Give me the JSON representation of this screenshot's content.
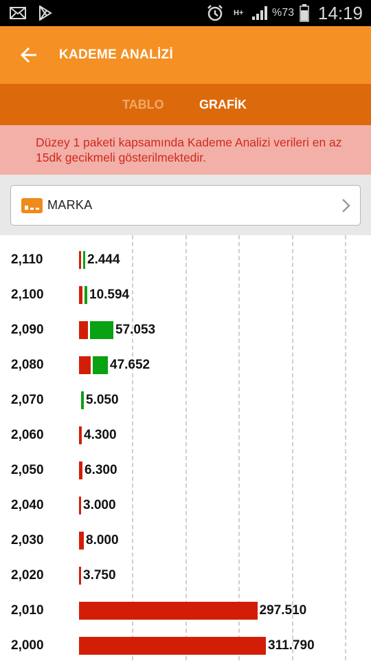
{
  "status_bar": {
    "network": "H+",
    "battery": "%73",
    "time": "14:19"
  },
  "header": {
    "title": "KADEME ANALİZİ",
    "back_icon": "arrow-left-icon"
  },
  "tabs": [
    {
      "label": "TABLO",
      "active": false
    },
    {
      "label": "GRAFİK",
      "active": true
    }
  ],
  "notice": {
    "text": "Düzey 1 paketi kapsamında Kademe Analizi verileri en az 15dk gecikmeli gösterilmektedir."
  },
  "filter": {
    "label": "MARKA",
    "icon": "bar-chart-icon",
    "chevron": "chevron-right-icon"
  },
  "colors": {
    "accent": "#f59024",
    "tab_bar": "#dc6a0c",
    "sell": "#d21e07",
    "buy": "#0aa113"
  },
  "chart_data": {
    "type": "bar",
    "orientation": "horizontal",
    "categories": [
      "2,110",
      "2,100",
      "2,090",
      "2,080",
      "2,070",
      "2,060",
      "2,050",
      "2,040",
      "2,030",
      "2,020",
      "2,010",
      "2,000"
    ],
    "value_labels": [
      "2.444",
      "10.594",
      "57.053",
      "47.652",
      "5.050",
      "4.300",
      "6.300",
      "3.000",
      "8.000",
      "3.750",
      "297.510",
      "311.790"
    ],
    "series": [
      {
        "color": "#d21e07",
        "values": [
          2000,
          6000,
          15000,
          20000,
          0,
          4300,
          6300,
          3000,
          8000,
          3750,
          297510,
          311790
        ]
      },
      {
        "color": "#0aa113",
        "values": [
          2444,
          4594,
          42053,
          27652,
          5050,
          0,
          0,
          0,
          0,
          0,
          0,
          0
        ]
      }
    ],
    "xlim": [
      0,
      350000
    ],
    "grid": true,
    "legend": "none"
  }
}
